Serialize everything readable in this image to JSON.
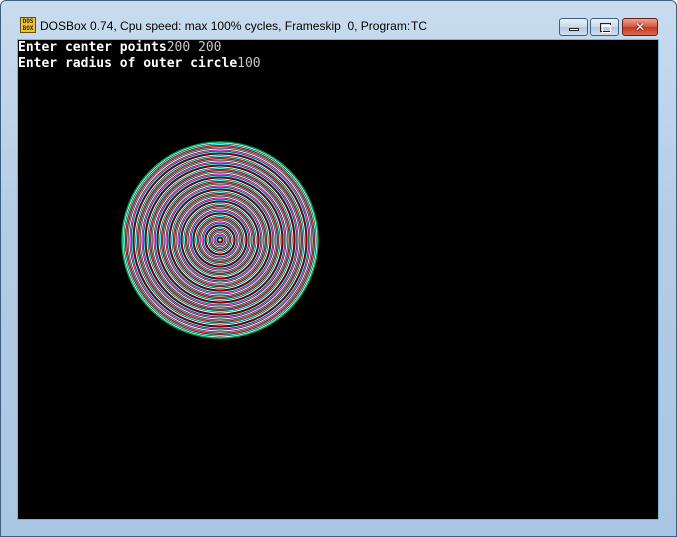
{
  "window": {
    "title": "DOSBox 0.74, Cpu speed: max 100% cycles, Frameskip  0, Program:",
    "program": "TC",
    "icon": "dosbox-icon",
    "icon_text": "DOS BOX",
    "controls": {
      "minimize_icon": "minimize-icon",
      "maximize_icon": "maximize-icon",
      "close_icon": "close-icon",
      "close_glyph": "✕"
    }
  },
  "console": {
    "lines": [
      {
        "prompt": "Enter center points",
        "value": "200 200"
      },
      {
        "prompt": "Enter radius of outer circle",
        "value": "100"
      }
    ]
  },
  "drawing": {
    "type": "concentric-circles",
    "center": "200 200",
    "outer_radius": "100",
    "ring_colors": [
      "#ffffff",
      "#55ffff",
      "#ff5555",
      "#aaaaaa",
      "#ffffff",
      "#ff55ff",
      "#55ffff",
      "#aa0000"
    ],
    "outer_ring_color": "#00aa55",
    "background": "#000000"
  }
}
